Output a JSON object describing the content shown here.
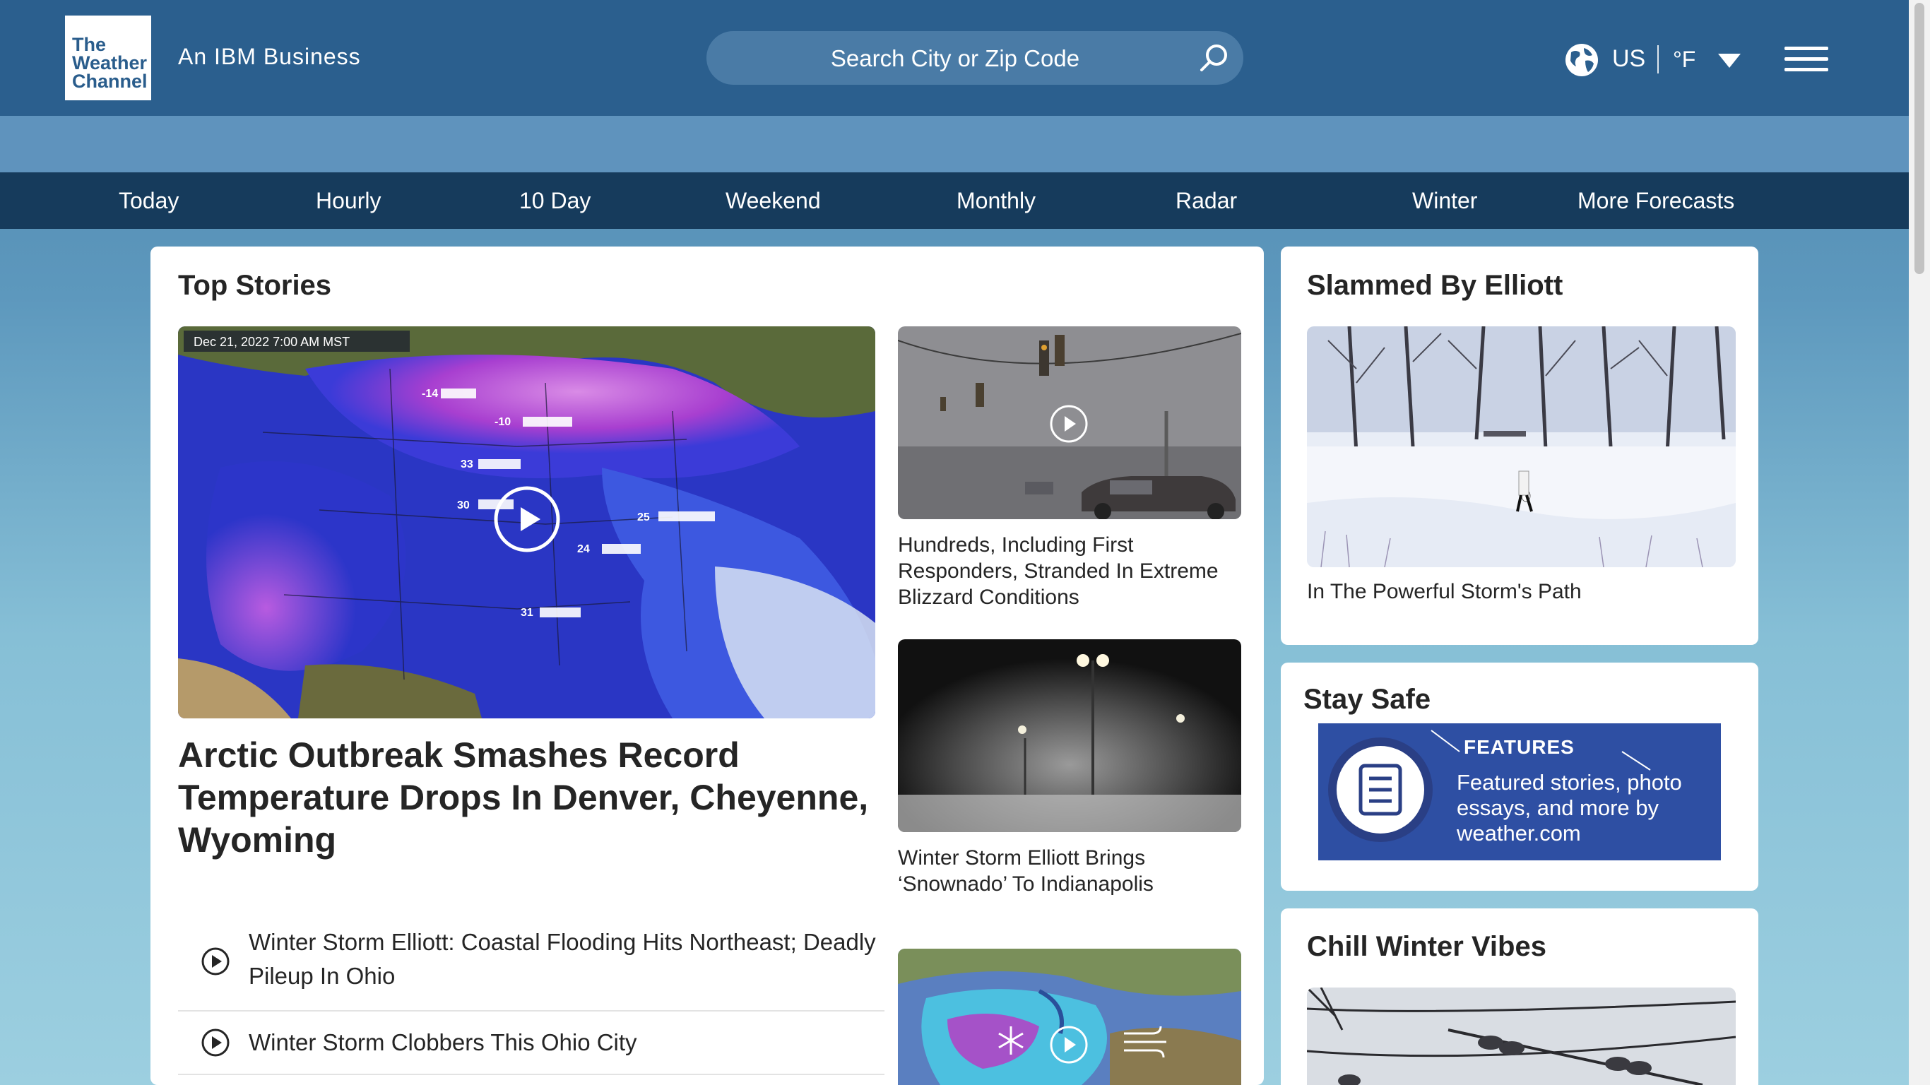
{
  "header": {
    "logo_lines": [
      "The",
      "Weather",
      "Channel"
    ],
    "tagline": "An IBM Business",
    "search_placeholder": "Search City or Zip Code",
    "locale": "US",
    "unit": "°F"
  },
  "nav": [
    "Today",
    "Hourly",
    "10 Day",
    "Weekend",
    "Monthly",
    "Radar",
    "Winter",
    "More Forecasts"
  ],
  "top_stories": {
    "title": "Top Stories",
    "main_image_stamp": "Dec 21, 2022   7:00 AM MST",
    "main_headline": "Arctic Outbreak Smashes Record Temperature Drops In Denver, Cheyenne, Wyoming",
    "side_stories": [
      "Hundreds, Including First Responders, Stranded In Extreme Blizzard Conditions",
      "Winter Storm Elliott Brings ‘Snownado’ To Indianapolis"
    ],
    "video_links": [
      "Winter Storm Elliott: Coastal Flooding Hits Northeast; Deadly Pileup In Ohio",
      "Winter Storm Clobbers This Ohio City"
    ]
  },
  "slammed": {
    "title": "Slammed By Elliott",
    "caption": "In The Powerful Storm's Path"
  },
  "stay_safe": {
    "title": "Stay Safe",
    "label": "FEATURES",
    "description": "Featured stories, photo essays, and more by weather.com"
  },
  "chill": {
    "title": "Chill Winter Vibes"
  },
  "colors": {
    "header": "#2b5f8e",
    "nav": "#163b5c",
    "feature_banner": "#2e4fa3"
  },
  "icons": [
    "search-icon",
    "globe-icon",
    "caret-down-icon",
    "menu-icon",
    "play-icon",
    "document-icon"
  ]
}
